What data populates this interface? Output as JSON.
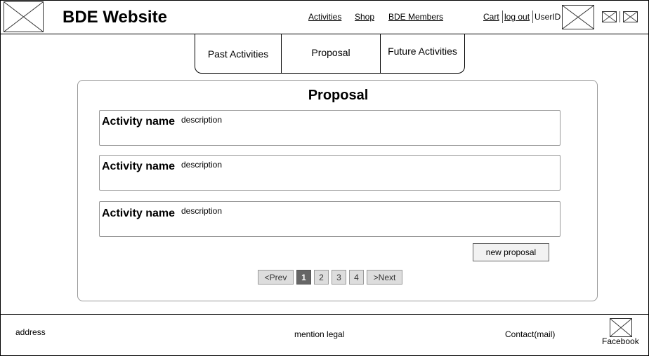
{
  "header": {
    "title": "BDE Website",
    "nav": [
      "Activities",
      "Shop",
      "BDE Members"
    ],
    "cart": "Cart",
    "logout": "log out",
    "user_id": "UserID"
  },
  "tabs": [
    "Past Activities",
    "Proposal",
    "Future Activities"
  ],
  "panel": {
    "title": "Proposal",
    "activities": [
      {
        "name": "Activity name",
        "description": "description"
      },
      {
        "name": "Activity name",
        "description": "description"
      },
      {
        "name": "Activity name",
        "description": "description"
      }
    ],
    "new_button": "new proposal"
  },
  "pagination": {
    "prev": "<Prev",
    "pages": [
      "1",
      "2",
      "3",
      "4"
    ],
    "current": "1",
    "next": ">Next"
  },
  "footer": {
    "address": "address",
    "legal": "mention legal",
    "contact": "Contact(mail)",
    "facebook": "Facebook"
  }
}
